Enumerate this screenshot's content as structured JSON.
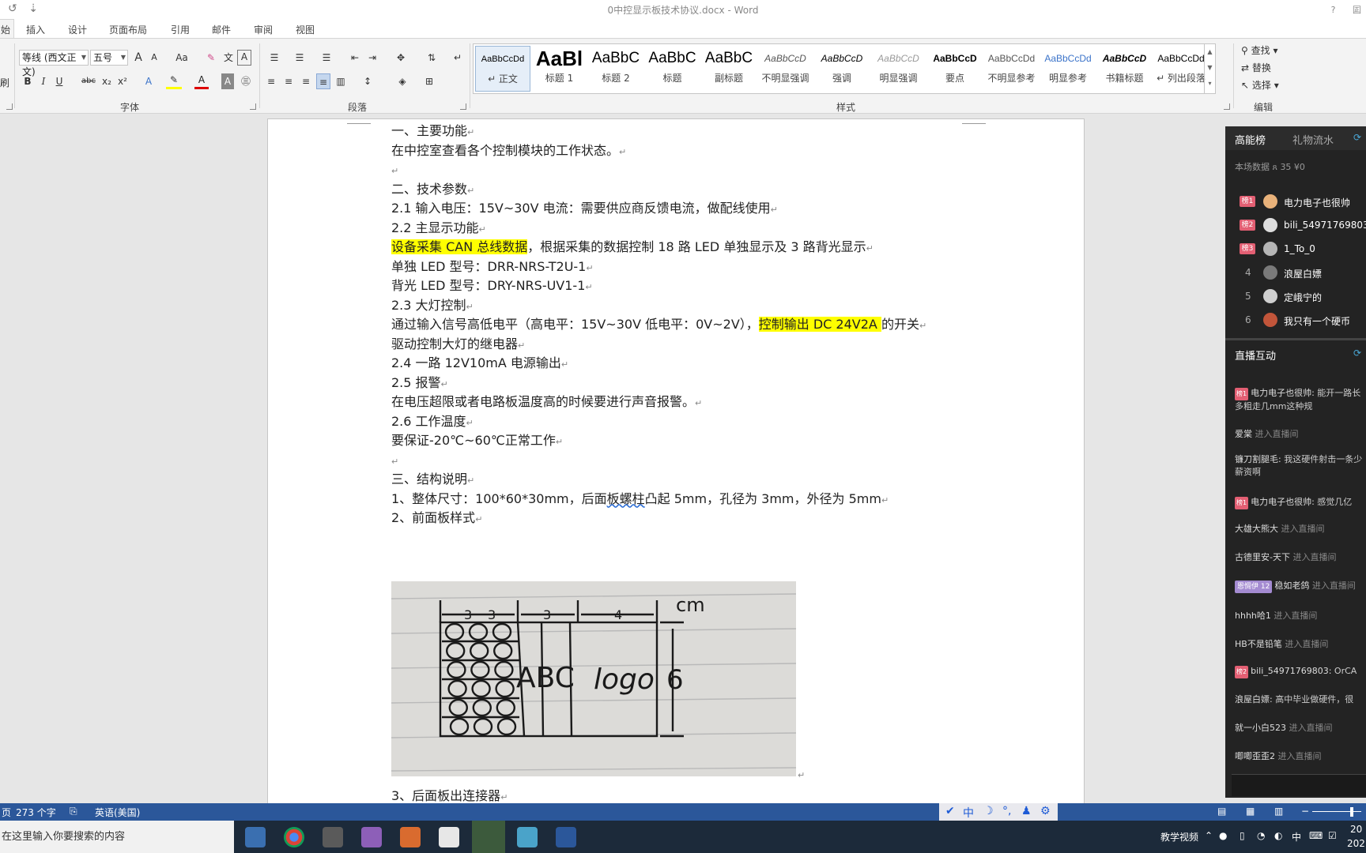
{
  "window": {
    "title": "0中控显示板技术协议.docx - Word",
    "help_label": "?",
    "restore_label": "囸"
  },
  "quick_access": {
    "undo_label": "↺",
    "customize_label": "⇣"
  },
  "ribbon_tabs": [
    "始",
    "插入",
    "设计",
    "页面布局",
    "引用",
    "邮件",
    "审阅",
    "视图"
  ],
  "ribbon": {
    "clipboard_fragment": "刷",
    "font": {
      "font_name": "等线 (西文正文)",
      "font_size": "五号",
      "group_label": "字体",
      "grow_label": "A",
      "shrink_label": "A",
      "case_label": "Aa",
      "bold": "B",
      "italic": "I",
      "underline": "U",
      "strike": "abc",
      "subscript": "x₂",
      "superscript": "x²",
      "font_color_label": "A"
    },
    "paragraph": {
      "group_label": "段落"
    },
    "styles": {
      "group_label": "样式",
      "items": [
        {
          "sample": "AaBbCcDd",
          "name": "↵ 正文",
          "selected": true
        },
        {
          "sample": "AaBl",
          "name": "标题 1",
          "selected": false
        },
        {
          "sample": "AaBbC",
          "name": "标题 2",
          "selected": false
        },
        {
          "sample": "AaBbC",
          "name": "标题",
          "selected": false
        },
        {
          "sample": "AaBbC",
          "name": "副标题",
          "selected": false
        },
        {
          "sample": "AaBbCcD",
          "name": "不明显强调",
          "selected": false
        },
        {
          "sample": "AaBbCcD",
          "name": "强调",
          "selected": false
        },
        {
          "sample": "AaBbCcD",
          "name": "明显强调",
          "selected": false
        },
        {
          "sample": "AaBbCcD",
          "name": "要点",
          "selected": false
        },
        {
          "sample": "AaBbCcDd",
          "name": "不明显参考",
          "selected": false
        },
        {
          "sample": "AaBbCcDd",
          "name": "明显参考",
          "selected": false
        },
        {
          "sample": "AaBbCcD",
          "name": "书籍标题",
          "selected": false
        },
        {
          "sample": "AaBbCcDd",
          "name": "↵ 列出段落",
          "selected": false
        }
      ]
    },
    "editing": {
      "group_label": "编辑",
      "find": "查找",
      "replace": "替换",
      "select": "选择"
    }
  },
  "document": {
    "lines": [
      {
        "text": "一、主要功能"
      },
      {
        "text": "在中控室查看各个控制模块的工作状态。"
      },
      {
        "text": ""
      },
      {
        "text": "二、技术参数"
      },
      {
        "text": "2.1 输入电压：15V~30V    电流：需要供应商反馈电流，做配线使用"
      },
      {
        "text": "2.2 主显示功能"
      },
      {
        "hl": "设备采集 CAN 总线数据",
        "text": "，根据采集的数据控制 18 路 LED 单独显示及 3 路背光显示"
      },
      {
        "text": "单独 LED 型号：DRR-NRS-T2U-1"
      },
      {
        "text": "背光 LED 型号：DRY-NRS-UV1-1"
      },
      {
        "text": "2.3 大灯控制"
      },
      {
        "pre": "通过输入信号高低电平（高电平：15V~30V  低电平：0V~2V），",
        "hl": "控制输出 DC 24V2A ",
        "text": "的开关"
      },
      {
        "text": "驱动控制大灯的继电器"
      },
      {
        "text": "2.4 一路 12V10mA 电源输出"
      },
      {
        "text": "2.5 报警"
      },
      {
        "text": "在电压超限或者电路板温度高的时候要进行声音报警。"
      },
      {
        "text": "2.6 工作温度"
      },
      {
        "text": "要保证-20℃~60℃正常工作"
      },
      {
        "text": ""
      },
      {
        "text": "三、结构说明"
      },
      {
        "pre": "1、整体尺寸：100*60*30mm，后面",
        "squiggle": "板螺柱",
        "text": "凸起 5mm，孔径为 3mm，外径为 5mm"
      },
      {
        "text": "2、前面板样式"
      }
    ],
    "after_image": "3、后面板出连接器",
    "paragraph_mark": "↵",
    "sketch": {
      "dims": [
        "3",
        "3",
        "3",
        "4"
      ],
      "unit": "cm",
      "letters": "ABC",
      "logo": "logo",
      "height": "6"
    }
  },
  "live_panel": {
    "tab_rank": "高能榜",
    "tab_gift": "礼物流水",
    "stats": "本场数据  ጸ 35  ¥0",
    "ranks": [
      {
        "badge": "榜1",
        "name": "电力电子也很帅",
        "color": "#e9b27a"
      },
      {
        "badge": "榜2",
        "name": "bili_54971769803",
        "color": "#dddddd"
      },
      {
        "badge": "榜3",
        "name": "1_To_0",
        "color": "#b5b5b5"
      },
      {
        "num": "4",
        "name": "浪屋白嫖",
        "color": "#7a7a7a"
      },
      {
        "num": "5",
        "name": "定峨宁的",
        "color": "#cfcfcf"
      },
      {
        "num": "6",
        "name": "我只有一个硬币",
        "color": "#c2553a"
      }
    ],
    "interact_title": "直播互动",
    "messages": [
      {
        "badge": "榜1",
        "user": "电力电子也很帅:",
        "text": " 能开一路长多粗走几mm这种规"
      },
      {
        "user": "爱棠",
        "sys": " 进入直播间"
      },
      {
        "user": "镰刀割腿毛:",
        "text": " 我这硬件射击一条少薪资啊"
      },
      {
        "badge": "榜1",
        "user": "电力电子也很帅:",
        "text": " 感觉几亿"
      },
      {
        "user": "大雄大熊大",
        "sys": " 进入直播间"
      },
      {
        "user": "古德里安-天下",
        "sys": " 进入直播间"
      },
      {
        "badge2": "恩惆伊 12",
        "user": "稳如老鸽",
        "sys": " 进入直播间"
      },
      {
        "user": "hhhh哈1",
        "sys": " 进入直播间"
      },
      {
        "user": "HB不是铅笔",
        "sys": " 进入直播间"
      },
      {
        "badge": "榜2",
        "user": "bili_54971769803:",
        "text": " OrCA"
      },
      {
        "user": "浪屋白嫖:",
        "text": " 高中毕业做硬件，很"
      },
      {
        "user": "就一小白523",
        "sys": " 进入直播间"
      },
      {
        "user": "唧唧歪歪2",
        "sys": " 进入直播间"
      }
    ]
  },
  "statusbar": {
    "page_fragment": "页",
    "word_count": "273 个字",
    "language": "英语(美国)",
    "ime": [
      "中",
      "☽",
      "°,",
      "♟",
      "⚙"
    ]
  },
  "taskbar": {
    "search_placeholder": "在这里输入你要搜索的内容",
    "tray_label": "教学视频",
    "ime_mode": "中",
    "time_fragment": "20",
    "date_fragment": "202"
  },
  "colors": {
    "word_blue": "#2b579a",
    "highlight": "#ffff00",
    "live_panel_bg": "#232323",
    "rank_badge": "#e35f73"
  }
}
